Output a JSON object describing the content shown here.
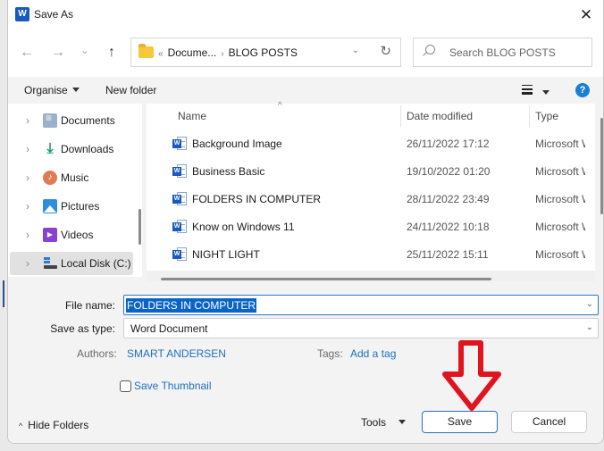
{
  "window": {
    "app_icon": "word-icon",
    "title": "Save As",
    "close_glyph": "✕"
  },
  "navigation": {
    "back_glyph": "←",
    "forward_glyph": "→",
    "recent_glyph": "⌄",
    "up_glyph": "↑",
    "address": {
      "overflow_glyph": "«",
      "segments": [
        "Docume...",
        "BLOG POSTS"
      ],
      "separator_glyph": "›",
      "dropdown_glyph": "⌄",
      "refresh_glyph": "↻"
    },
    "search": {
      "placeholder": "Search BLOG POSTS"
    }
  },
  "toolbar": {
    "organise_label": "Organise",
    "new_folder_label": "New folder",
    "help_glyph": "?"
  },
  "sidebar": {
    "items": [
      {
        "label": "Documents",
        "icon": "documents-icon",
        "selected": false
      },
      {
        "label": "Downloads",
        "icon": "downloads-icon",
        "selected": false
      },
      {
        "label": "Music",
        "icon": "music-icon",
        "selected": false
      },
      {
        "label": "Pictures",
        "icon": "pictures-icon",
        "selected": false
      },
      {
        "label": "Videos",
        "icon": "videos-icon",
        "selected": false
      },
      {
        "label": "Local Disk (C:)",
        "icon": "local-disk-icon",
        "selected": true
      }
    ],
    "chevron_glyph": "›"
  },
  "file_list": {
    "columns": [
      "Name",
      "Date modified",
      "Type"
    ],
    "sort_glyph": "^",
    "files": [
      {
        "name": "Background Image",
        "date": "26/11/2022 17:12",
        "type": "Microsoft Word Document"
      },
      {
        "name": "Business Basic",
        "date": "19/10/2022 01:20",
        "type": "Microsoft Word Document"
      },
      {
        "name": "FOLDERS IN COMPUTER",
        "date": "28/11/2022 23:49",
        "type": "Microsoft Word Document"
      },
      {
        "name": "Know on Windows 11",
        "date": "24/11/2022 10:18",
        "type": "Microsoft Word Document"
      },
      {
        "name": "NIGHT LIGHT",
        "date": "25/11/2022 15:11",
        "type": "Microsoft Word Document"
      }
    ]
  },
  "form": {
    "file_name_label": "File name:",
    "file_name_value": "FOLDERS IN COMPUTER",
    "save_as_type_label": "Save as type:",
    "save_as_type_value": "Word Document",
    "dropdown_glyph": "⌄",
    "authors_label": "Authors:",
    "authors_value": "SMART ANDERSEN",
    "tags_label": "Tags:",
    "tags_value": "Add a tag",
    "save_thumbnail_label": "Save Thumbnail",
    "save_thumbnail_checked": false
  },
  "footer": {
    "hide_folders_label": "Hide Folders",
    "hide_folders_glyph": "^",
    "tools_label": "Tools",
    "save_label": "Save",
    "cancel_label": "Cancel"
  },
  "annotation": {
    "arrow_color": "#e0141e",
    "arrow_points_to": "save-button"
  },
  "colors": {
    "accent": "#0a64c8",
    "link": "#1f6fc1",
    "selection_bg": "#e1e1e1"
  }
}
